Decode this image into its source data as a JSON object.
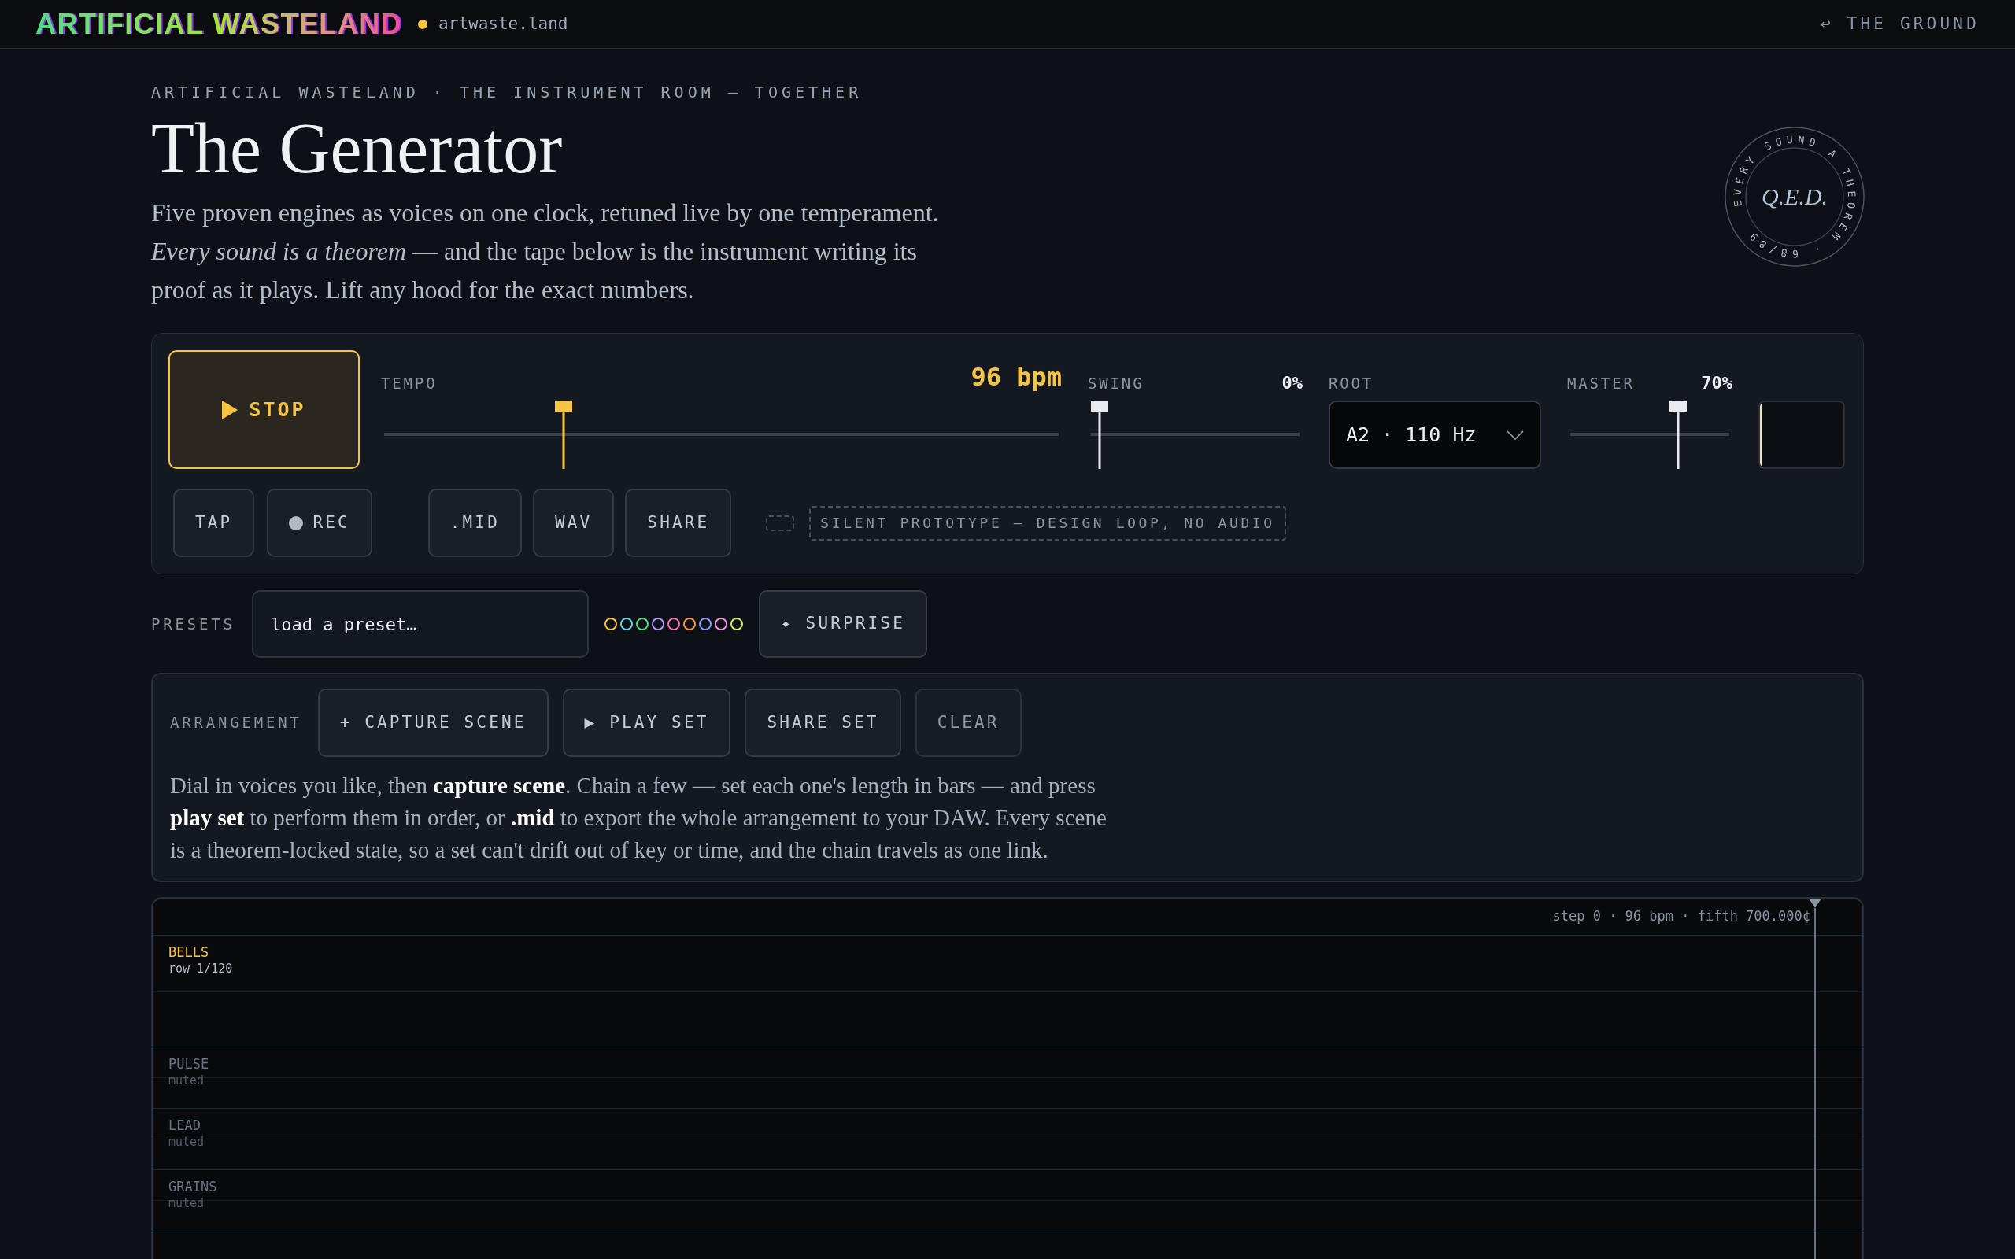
{
  "topbar": {
    "logo": "ARTIFICIAL WASTELAND",
    "domain": "artwaste.land",
    "back_link": "↩ THE GROUND"
  },
  "header": {
    "eyebrow": "ARTIFICIAL WASTELAND · THE INSTRUMENT ROOM — TOGETHER",
    "title": "The Generator",
    "intro": "Five proven engines as voices on one clock, retuned live by one temperament. *Every sound is a theorem* — and the tape below is the instrument writing its proof as it plays. Lift any hood for the exact numbers.",
    "stamp": {
      "ring": "EVERY SOUND A THEOREM · 68/89",
      "center": "Q.E.D."
    }
  },
  "transport": {
    "play_button": {
      "label": "STOP"
    },
    "controls": [
      {
        "kind": "slider",
        "label": "TEMPO",
        "reading": "96 bpm",
        "level": 0.26,
        "accent": true
      },
      {
        "kind": "slider",
        "label": "SWING",
        "reading": "0%",
        "level": 0,
        "accent": false
      },
      {
        "kind": "select",
        "label": "ROOT",
        "value": "A2 · 110 Hz"
      },
      {
        "kind": "slider",
        "label": "MASTER",
        "reading": "70%",
        "level": 0.7,
        "accent": false
      },
      {
        "kind": "meter",
        "level": 0.03
      }
    ],
    "take_buttons": [
      {
        "kind": "plain",
        "label": "TAP"
      },
      {
        "kind": "record",
        "label": "REC"
      }
    ],
    "export_buttons": [
      {
        "label": ".MID"
      },
      {
        "label": "WAV"
      },
      {
        "label": "SHARE"
      }
    ],
    "notice": "SILENT PROTOTYPE — DESIGN LOOP, NO AUDIO"
  },
  "presets": {
    "label": "PRESETS",
    "value": "load a preset…",
    "dots": [
      {
        "color": "#f5c542"
      },
      {
        "color": "#5fd3e0"
      },
      {
        "color": "#4ade80"
      },
      {
        "color": "#b794f6"
      },
      {
        "color": "#f472b6"
      },
      {
        "color": "#fb923c"
      },
      {
        "color": "#8b9cf8"
      },
      {
        "color": "#f28ed8"
      },
      {
        "color": "#d4ee6a"
      }
    ],
    "surprise_button": "✦ SURPRISE"
  },
  "arrangement": {
    "label": "ARRANGEMENT",
    "buttons": [
      {
        "label": "+ CAPTURE SCENE",
        "disabled": false
      },
      {
        "label": "▶ PLAY SET",
        "disabled": false
      },
      {
        "label": "SHARE SET",
        "disabled": false
      },
      {
        "label": "CLEAR",
        "disabled": true
      }
    ],
    "text": "Dial in voices you like, then **capture scene**. Chain a few — set each one's length in bars — and press **play set** to perform them in order, or **.mid** to export the whole arrangement to your DAW. Every scene is a theorem-locked state, so a set can't drift out of key or time, and the chain travels as one link."
  },
  "tape": {
    "status": "step 0 · 96 bpm · fifth 700.000¢",
    "lanes": [
      {
        "name": "BELLS",
        "detail": "row 1/120",
        "muted": false
      },
      {
        "name": "PULSE",
        "detail": "muted",
        "muted": true
      },
      {
        "name": "LEAD",
        "detail": "muted",
        "muted": true
      },
      {
        "name": "GRAINS",
        "detail": "muted",
        "muted": true
      }
    ]
  }
}
